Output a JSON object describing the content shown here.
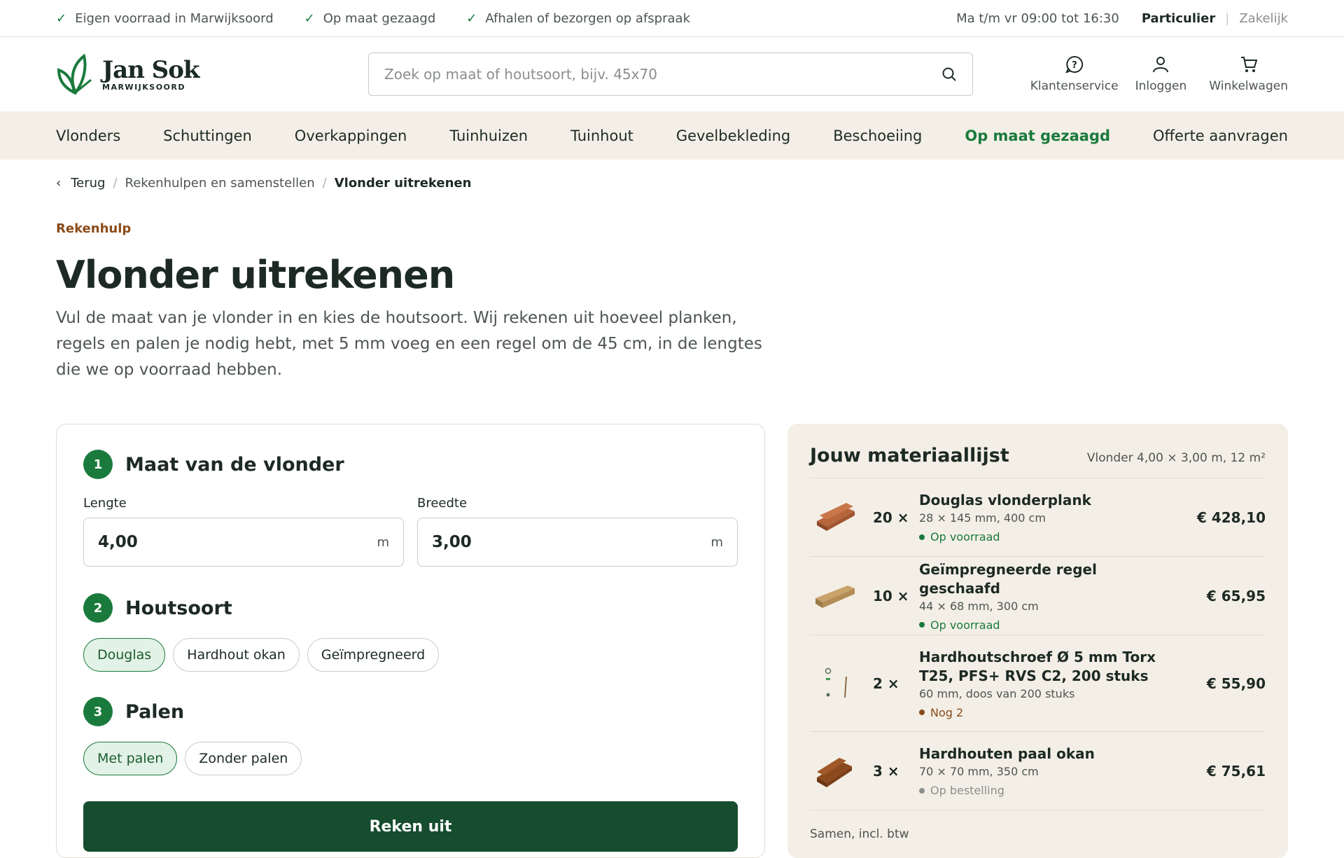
{
  "topbar": {
    "usps": [
      "Eigen voorraad in Marwijksoord",
      "Op maat gezaagd",
      "Afhalen of bezorgen op afspraak"
    ],
    "hours": "Ma t/m vr 09:00 tot 16:30",
    "segment_active": "Particulier",
    "segment_inactive": "Zakelijk"
  },
  "header": {
    "logo_name": "Jan Sok",
    "logo_sub": "MARWIJKSOORD",
    "search_placeholder": "Zoek op maat of houtsoort, bijv. 45x70",
    "actions": {
      "service": "Klantenservice",
      "login": "Inloggen",
      "cart": "Winkelwagen"
    }
  },
  "nav": [
    "Vlonders",
    "Schuttingen",
    "Overkappingen",
    "Tuinhuizen",
    "Tuinhout",
    "Gevelbekleding",
    "Beschoeiing",
    "Op maat gezaagd",
    "Offerte aanvragen"
  ],
  "breadcrumb": {
    "back": "Terug",
    "parent": "Rekenhulpen en samenstellen",
    "current": "Vlonder uitrekenen"
  },
  "hero": {
    "eyebrow": "Rekenhulp",
    "title": "Vlonder uitrekenen",
    "intro": "Vul de maat van je vlonder in en kies de houtsoort. Wij rekenen uit hoeveel planken, regels en palen je nodig hebt, met 5 mm voeg en een regel om de 45 cm, in de lengtes die we op voorraad hebben."
  },
  "form": {
    "step1": {
      "num": "1",
      "label": "Maat van de vlonder"
    },
    "length": {
      "label": "Lengte",
      "value": "4,00",
      "unit": "m"
    },
    "width": {
      "label": "Breedte",
      "value": "3,00",
      "unit": "m"
    },
    "step2": {
      "num": "2",
      "label": "Houtsoort"
    },
    "wood_options": [
      "Douglas",
      "Hardhout okan",
      "Geïmpregneerd"
    ],
    "step3": {
      "num": "3",
      "label": "Palen"
    },
    "post_options": [
      "Met palen",
      "Zonder palen"
    ],
    "submit": "Reken uit"
  },
  "summary": {
    "title": "Jouw materiaallijst",
    "meta": "Vlonder 4,00 × 3,00 m, 12 m²",
    "items": [
      {
        "qty": "20 ×",
        "name": "Douglas vlonderplank",
        "spec": "28 × 145 mm, 400 cm",
        "stock": "Op voorraad",
        "price": "€ 428,10"
      },
      {
        "qty": "10 ×",
        "name": "Geïmpregneerde regel geschaafd",
        "spec": "44 × 68 mm, 300 cm",
        "stock": "Op voorraad",
        "price": "€ 65,95"
      },
      {
        "qty": "2 ×",
        "name": "Hardhoutschroef Ø 5 mm Torx T25, PFS+ RVS C2, 200 stuks",
        "spec": "60 mm, doos van 200 stuks",
        "stock": "Nog 2",
        "price": "€ 55,90"
      },
      {
        "qty": "3 ×",
        "name": "Hardhouten paal okan",
        "spec": "70 × 70 mm, 350 cm",
        "stock": "Op bestelling",
        "price": "€ 75,61"
      }
    ],
    "footer": "Samen, incl. btw"
  },
  "colors": {
    "accent": "#1a7a3c",
    "dark_green": "#154d2e",
    "brown": "#8a4b1a",
    "beige": "#f3efe6"
  }
}
